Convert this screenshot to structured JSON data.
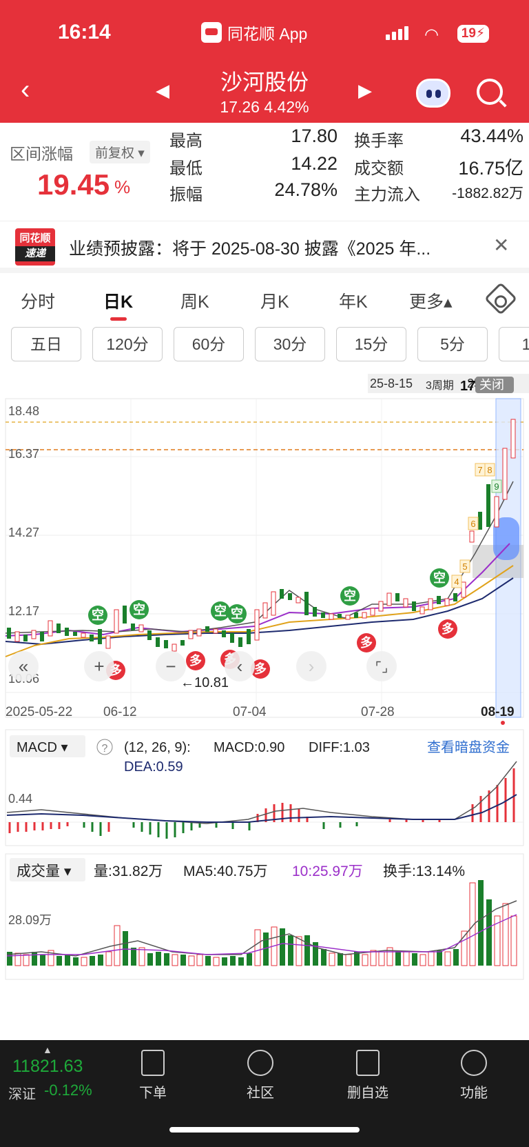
{
  "status": {
    "time": "16:14",
    "app": "同花顺 App",
    "battery": "19"
  },
  "header": {
    "name": "沙河股份",
    "sub": "17.26  4.42%"
  },
  "summary": {
    "range_label": "区间涨幅",
    "adjust": "前复权 ▾",
    "range_value": "19.45",
    "range_unit": "%",
    "stats": [
      {
        "label": "最高",
        "value": "17.80"
      },
      {
        "label": "最低",
        "value": "14.22"
      },
      {
        "label": "振幅",
        "value": "24.78%"
      },
      {
        "label": "换手率",
        "value": "43.44%"
      },
      {
        "label": "成交额",
        "value": "16.75亿"
      },
      {
        "label": "主力流入",
        "value": "-1882.82万"
      }
    ]
  },
  "banner": {
    "logo_top": "同花顺",
    "logo_bottom": "速递",
    "text": "业绩预披露：将于 2025-08-30 披露《2025 年..."
  },
  "tabs": [
    "分时",
    "日K",
    "周K",
    "月K",
    "年K",
    "更多▴"
  ],
  "periods": [
    "五日",
    "120分",
    "60分",
    "30分",
    "15分",
    "5分",
    "1"
  ],
  "chart": {
    "top_range": "25-8-15",
    "top_period": "3周期",
    "top_end": "25-8-19",
    "close_btn": "关闭",
    "partial_price": "17",
    "y_ticks": [
      "18.48",
      "16.37",
      "14.27",
      "12.17",
      "10.06"
    ],
    "x_ticks": [
      "2025-05-22",
      "06-12",
      "07-04",
      "07-28",
      "08-19"
    ],
    "low_marker": "←10.81",
    "signal_short": "空",
    "signal_long": "多",
    "tags": [
      "6",
      "7",
      "8",
      "9",
      "4",
      "5"
    ],
    "macd": {
      "title": "MACD ▾",
      "help": "?",
      "params": "(12, 26, 9):",
      "macd": "MACD:0.90",
      "diff": "DIFF:1.03",
      "dea": "DEA:0.59",
      "link": "查看暗盘资金",
      "tick": "0.44"
    },
    "volume": {
      "title": "成交量 ▾",
      "vol": "量:31.82万",
      "ma5": "MA5:40.75万",
      "ma10": "10:25.97万",
      "turnover": "换手:13.14%",
      "tick": "28.09万"
    }
  },
  "chart_data": {
    "type": "candlestick",
    "ylim": [
      10.06,
      18.48
    ],
    "summary": {
      "high": 17.8,
      "low": 14.22,
      "last": 17.26,
      "change_pct": 4.42
    },
    "low_marker": 10.81,
    "macd": {
      "macd": 0.9,
      "diff": 1.03,
      "dea": 0.59
    },
    "volume": {
      "vol": "31.82万",
      "ma5": "40.75万",
      "ma10": "25.97万"
    }
  },
  "bottom": {
    "index_value": "11821.63",
    "index_name": "深证",
    "index_change": "-0.12%",
    "items": [
      "下单",
      "社区",
      "删自选",
      "功能"
    ]
  },
  "colors": {
    "red": "#e5313a",
    "green": "#1a7f2b",
    "purple": "#9b2fc9",
    "orange": "#e0a21a",
    "navy": "#1d2a6e"
  }
}
